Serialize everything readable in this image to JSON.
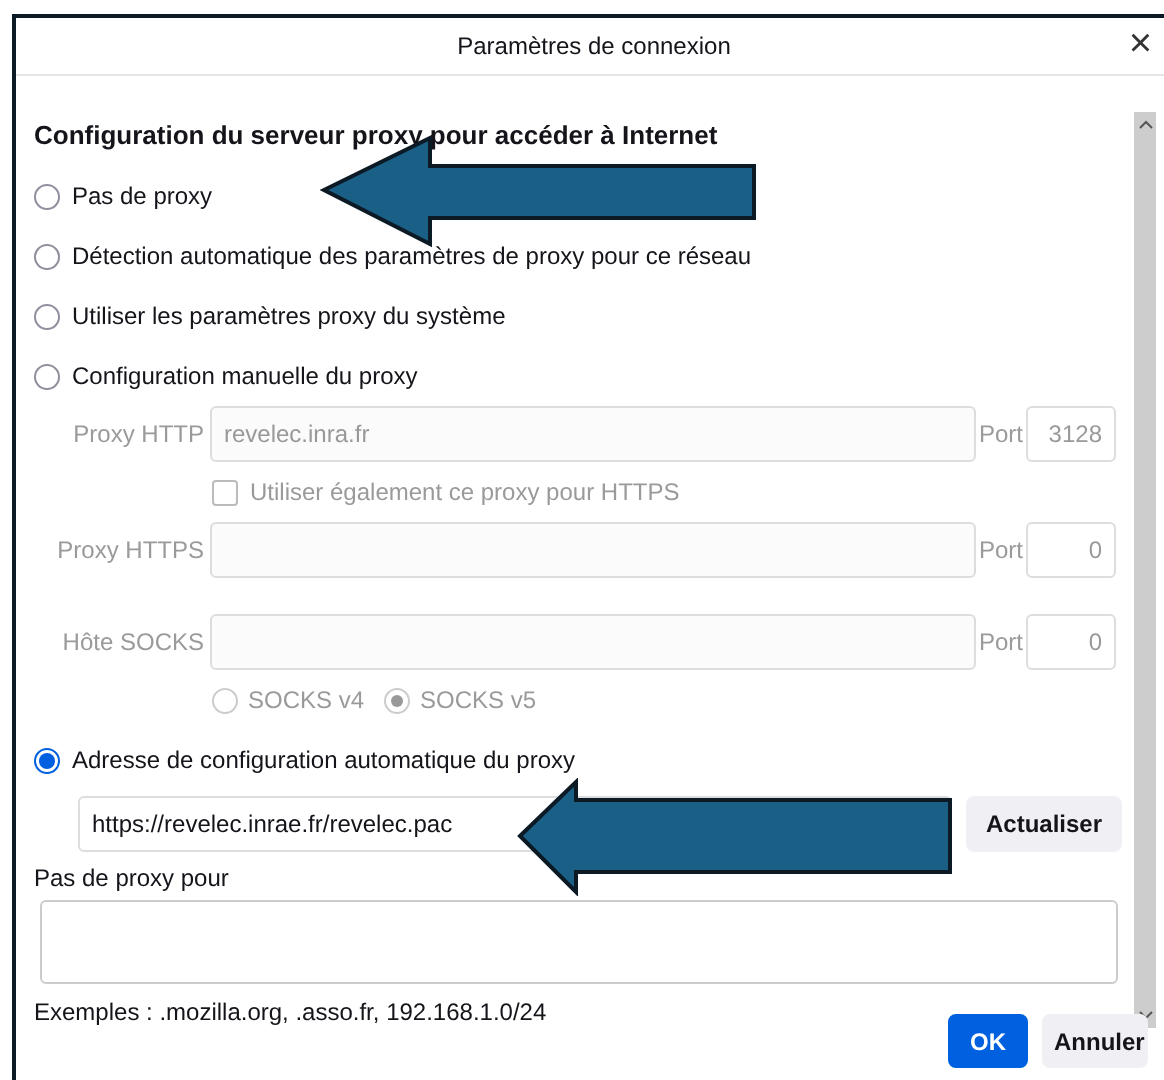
{
  "window": {
    "title": "Paramètres de connexion",
    "close": "×"
  },
  "heading": "Configuration du serveur proxy pour accéder à Internet",
  "modes": [
    {
      "label": "Pas de proxy",
      "selected": false
    },
    {
      "label": "Détection automatique des paramètres de proxy pour ce réseau",
      "selected": false
    },
    {
      "label": "Utiliser les paramètres proxy du système",
      "selected": false
    },
    {
      "label": "Configuration manuelle du proxy",
      "selected": false
    },
    {
      "label": "Adresse de configuration automatique du proxy",
      "selected": true
    }
  ],
  "manual": {
    "disabled": true,
    "proxies": [
      {
        "label": "Proxy HTTP",
        "value": "revelec.inra.fr",
        "port_label": "Port",
        "port": "3128"
      },
      {
        "label": "Proxy HTTPS",
        "port_label": "Port",
        "port": "0"
      },
      {
        "label": "Hôte SOCKS",
        "port_label": "Port",
        "port": "0"
      }
    ],
    "https_checkbox": {
      "label": "Utiliser également ce proxy pour HTTPS",
      "checked": false
    },
    "socks_versions": [
      {
        "label": "SOCKS v4",
        "selected": false
      },
      {
        "label": "SOCKS v5",
        "selected": true
      }
    ]
  },
  "auto": {
    "url": "https://revelec.inrae.fr/revelec.pac",
    "button": "Actualiser"
  },
  "no_proxy": {
    "label": "Pas de proxy pour"
  },
  "examples": "Exemples : .mozilla.org, .asso.fr, 192.168.1.0/24",
  "buttons": [
    {
      "label": "OK",
      "kind": "primary"
    },
    {
      "label": "Annuler",
      "kind": "secondary"
    }
  ]
}
